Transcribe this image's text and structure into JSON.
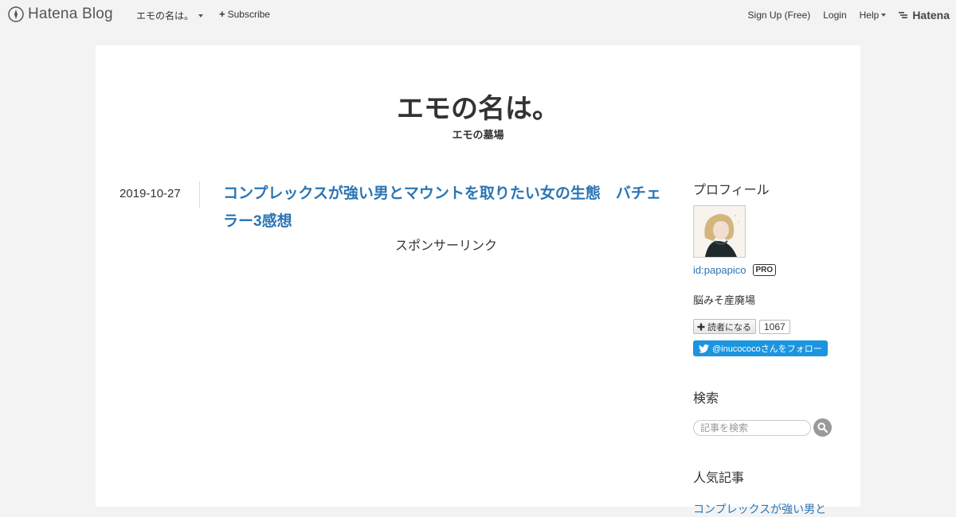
{
  "topbar": {
    "logo_text": "Hatena Blog",
    "blog_menu_label": "エモの名は。",
    "subscribe_label": "Subscribe",
    "signup_label": "Sign Up (Free)",
    "login_label": "Login",
    "help_label": "Help",
    "brand_label": "Hatena"
  },
  "blog": {
    "title": "エモの名は。",
    "description": "エモの墓場"
  },
  "entry": {
    "date": "2019-10-27",
    "title": "コンプレックスが強い男とマウントを取りたい女の生態　バチェラー3感想",
    "sponsor_label": "スポンサーリンク"
  },
  "sidebar": {
    "profile_title": "プロフィール",
    "profile_id": "id:papapico",
    "pro_badge": "PRO",
    "profile_desc": "脳みそ産廃場",
    "reader_button_label": "読者になる",
    "reader_count": "1067",
    "twitter_follow_label": "@inucococoさんをフォロー",
    "search_title": "検索",
    "search_placeholder": "記事を検索",
    "popular_title": "人気記事",
    "popular_first": "コンプレックスが強い男と"
  },
  "colors": {
    "link": "#2a75b5",
    "twitter": "#1b95e0",
    "background": "#f3f3f3"
  }
}
